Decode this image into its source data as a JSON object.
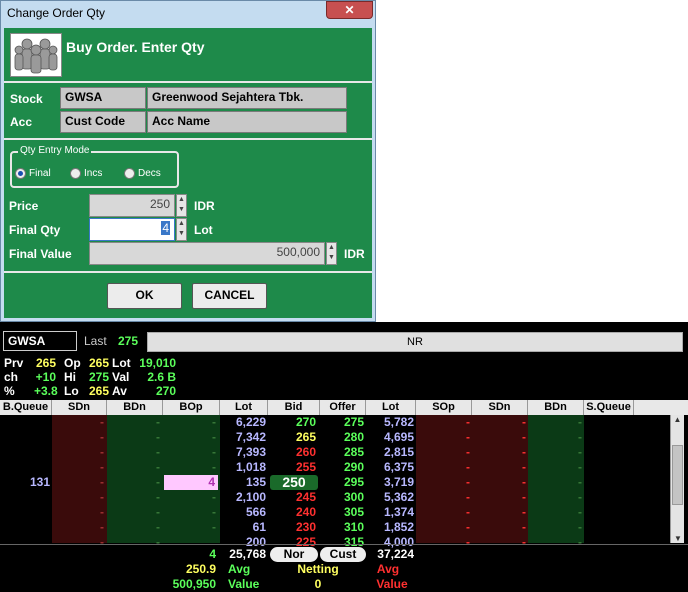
{
  "dialog": {
    "title": "Change Order Qty",
    "close": "✕",
    "heading": "Buy Order. Enter Qty",
    "stock_label": "Stock",
    "stock_code": "GWSA",
    "stock_name": "Greenwood Sejahtera Tbk.",
    "acc_label": "Acc",
    "cust_code": "Cust Code",
    "acc_name": "Acc Name",
    "qty_mode_title": "Qty Entry Mode",
    "modes": [
      "Final",
      "Incs",
      "Decs"
    ],
    "price_label": "Price",
    "price": "250",
    "price_unit": "IDR",
    "final_qty_label": "Final Qty",
    "final_qty": "4",
    "qty_unit": "Lot",
    "final_value_label": "Final Value",
    "final_value": "500,000",
    "value_unit": "IDR",
    "ok": "OK",
    "cancel": "CANCEL"
  },
  "book": {
    "code": "GWSA",
    "last_label": "Last",
    "last": "275",
    "nr": "NR",
    "stats": [
      [
        "Prv",
        "265",
        "Op",
        "265",
        "Lot",
        "19,010"
      ],
      [
        "ch",
        "+10",
        "Hi",
        "275",
        "Val",
        "2.6 B"
      ],
      [
        "%",
        "+3.8",
        "Lo",
        "265",
        "Av",
        "270"
      ]
    ],
    "columns": [
      "B.Queue",
      "SDn",
      "BDn",
      "BOp",
      "Lot",
      "Bid",
      "Offer",
      "Lot",
      "SOp",
      "SDn",
      "BDn",
      "S.Queue"
    ],
    "rows": [
      {
        "bq": "",
        "bop": "-",
        "blot": "6,229",
        "bid": "270",
        "offer": "275",
        "olot": "5,782"
      },
      {
        "bq": "",
        "bop": "-",
        "blot": "7,342",
        "bid": "265",
        "offer": "280",
        "olot": "4,695"
      },
      {
        "bq": "",
        "bop": "-",
        "blot": "7,393",
        "bid": "260",
        "offer": "285",
        "olot": "2,815"
      },
      {
        "bq": "",
        "bop": "-",
        "blot": "1,018",
        "bid": "255",
        "offer": "290",
        "olot": "6,375"
      },
      {
        "bq": "131",
        "bop": "4",
        "blot": "135",
        "bid": "250",
        "offer": "295",
        "olot": "3,719"
      },
      {
        "bq": "",
        "bop": "-",
        "blot": "2,100",
        "bid": "245",
        "offer": "300",
        "olot": "5,362"
      },
      {
        "bq": "",
        "bop": "-",
        "blot": "566",
        "bid": "240",
        "offer": "305",
        "olot": "1,374"
      },
      {
        "bq": "",
        "bop": "-",
        "blot": "61",
        "bid": "230",
        "offer": "310",
        "olot": "1,852"
      },
      {
        "bq": "",
        "bop": "",
        "blot": "200",
        "bid": "225",
        "offer": "315",
        "olot": "4,000"
      }
    ],
    "dash": "-",
    "totals": {
      "bop": "4",
      "blot": "25,768",
      "nor": "Nor",
      "cust": "Cust",
      "olot": "37,224"
    },
    "avg_value": "250.9",
    "avg_label": "Avg",
    "netting_label": "Netting",
    "avg_label_r": "Avg",
    "value_amount": "500,950",
    "value_label": "Value",
    "netting_value": "0",
    "value_label_r": "Value",
    "scroll_up": "▲",
    "scroll_down": "▼"
  }
}
